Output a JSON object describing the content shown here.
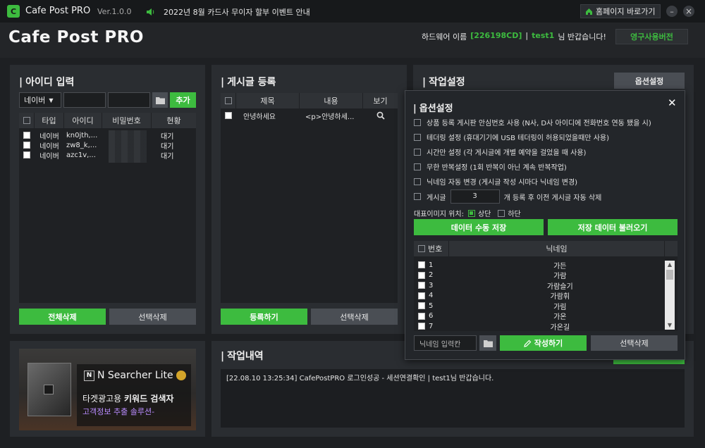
{
  "titlebar": {
    "logo_letter": "C",
    "app_name": "Cafe Post PRO",
    "version": "Ver.1.0.0",
    "notice": "2022년 8월 카드사 무이자 할부 이벤트 안내",
    "home_button": "홈페이지 바로가기",
    "minimize": "–",
    "close": "×"
  },
  "header": {
    "logo_text": "Cafe Post PRO",
    "hw_label": "하드웨어 이름",
    "hw_id": "[226198CD]",
    "sep": "|",
    "user": "test1",
    "greeting": "님 반갑습니다!",
    "license_button": "영구사용버전"
  },
  "id_panel": {
    "title": "아이디 입력",
    "platform_select": "네이버",
    "add_button": "추가",
    "columns": [
      "타입",
      "아이디",
      "비밀번호",
      "현황"
    ],
    "rows": [
      {
        "type": "네이버",
        "id": "kn0jth,...",
        "status": "대기"
      },
      {
        "type": "네이버",
        "id": "zw8_k,...",
        "status": "대기"
      },
      {
        "type": "네이버",
        "id": "azc1v,...",
        "status": "대기"
      }
    ],
    "delete_all": "전체삭제",
    "delete_selected": "선택삭제"
  },
  "post_panel": {
    "title": "게시글 등록",
    "columns": [
      "제목",
      "내용",
      "보기"
    ],
    "rows": [
      {
        "title": "안녕하세요",
        "content": "<p>안녕하세..."
      }
    ],
    "register": "등록하기",
    "delete_selected": "선택삭제"
  },
  "work_panel": {
    "title": "작업설정",
    "options_button": "옵션설정"
  },
  "options_popup": {
    "title": "옵션설정",
    "close": "✕",
    "options": [
      "상품 등록 게시판 안심번호 사용 (N사, D사 아이디에 전화번호 연동 됐을 시)",
      "테더링 설정 (휴대기기에 USB 테더링이 허용되었을때만 사용)",
      "시간만 설정 (각 게시글에 개별 예약을 걸었을 때 사용)",
      "무한 반복설정 (1회 반복이 아닌 계속 반복작업)",
      "닉네임 자동 변경 (게시글 작성 시마다 닉네임 변경)"
    ],
    "post_prefix": "게시글",
    "post_count": "3",
    "post_suffix": "개 등록 후 이전 게시글 자동 삭제",
    "image_pos_label": "대표이미지 위치:",
    "image_top": "상단",
    "image_bottom": "하단",
    "save_data": "데이터 수동 저장",
    "load_data": "저장 데이터 불러오기",
    "nick_columns": [
      "번호",
      "닉네임"
    ],
    "nick_rows": [
      {
        "no": "1",
        "nick": "가든"
      },
      {
        "no": "2",
        "nick": "가람"
      },
      {
        "no": "3",
        "nick": "가람슬기"
      },
      {
        "no": "4",
        "nick": "가람휘"
      },
      {
        "no": "5",
        "nick": "가림"
      },
      {
        "no": "6",
        "nick": "가온"
      },
      {
        "no": "7",
        "nick": "가온길"
      }
    ],
    "nick_input_placeholder": "닉네임 입력칸",
    "write_button": "작성하기",
    "delete_selected": "선택삭제"
  },
  "ad": {
    "brand": "N Searcher Lite",
    "line1_a": "타겟광고용 ",
    "line1_b": "키워드 검색자",
    "line2": "고객정보 추출 솔루션-"
  },
  "log_panel": {
    "title": "작업내역",
    "entries": [
      "[22.08.10 13:25:34]   CafePostPRO 로그인성공 - 세션연결확인  | test1님 반갑습니다."
    ]
  },
  "colors": {
    "accent": "#3dbb3f",
    "bg": "#1e2023",
    "panel": "#2a2d31"
  }
}
